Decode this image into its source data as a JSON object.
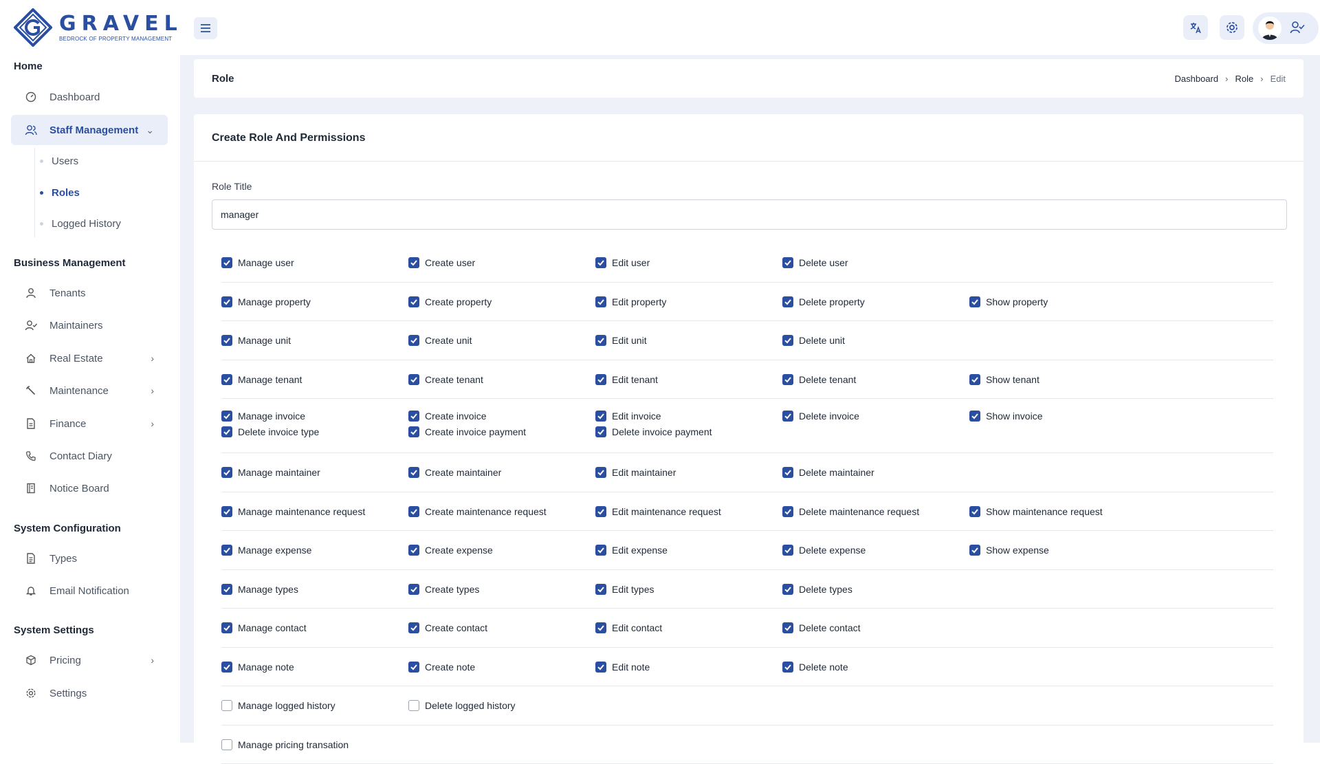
{
  "brand": {
    "name": "GRAVEL",
    "tagline": "BEDROCK OF PROPERTY MANAGEMENT"
  },
  "sidebar": {
    "sections": {
      "home": "Home",
      "business": "Business Management",
      "sysconfig": "System Configuration",
      "syssettings": "System Settings"
    },
    "items": {
      "dashboard": "Dashboard",
      "staff": "Staff Management",
      "users": "Users",
      "roles": "Roles",
      "logged": "Logged History",
      "tenants": "Tenants",
      "maintainers": "Maintainers",
      "realestate": "Real Estate",
      "maintenance": "Maintenance",
      "finance": "Finance",
      "contact": "Contact Diary",
      "notice": "Notice Board",
      "types": "Types",
      "email": "Email Notification",
      "pricing": "Pricing",
      "settings": "Settings"
    }
  },
  "header": {
    "title": "Role",
    "breadcrumb": [
      "Dashboard",
      "Role",
      "Edit"
    ]
  },
  "form": {
    "title": "Create Role And Permissions",
    "role_label": "Role Title",
    "role_value": "manager"
  },
  "permissions": [
    [
      {
        "l": "Manage user",
        "c": true
      },
      {
        "l": "Create user",
        "c": true
      },
      {
        "l": "Edit user",
        "c": true
      },
      {
        "l": "Delete user",
        "c": true
      }
    ],
    [
      {
        "l": "Manage property",
        "c": true
      },
      {
        "l": "Create property",
        "c": true
      },
      {
        "l": "Edit property",
        "c": true
      },
      {
        "l": "Delete property",
        "c": true
      },
      {
        "l": "Show property",
        "c": true
      }
    ],
    [
      {
        "l": "Manage unit",
        "c": true
      },
      {
        "l": "Create unit",
        "c": true
      },
      {
        "l": "Edit unit",
        "c": true
      },
      {
        "l": "Delete unit",
        "c": true
      }
    ],
    [
      {
        "l": "Manage tenant",
        "c": true
      },
      {
        "l": "Create tenant",
        "c": true
      },
      {
        "l": "Edit tenant",
        "c": true
      },
      {
        "l": "Delete tenant",
        "c": true
      },
      {
        "l": "Show tenant",
        "c": true
      }
    ],
    [
      {
        "l": "Manage invoice",
        "c": true
      },
      {
        "l": "Create invoice",
        "c": true
      },
      {
        "l": "Edit invoice",
        "c": true
      },
      {
        "l": "Delete invoice",
        "c": true
      },
      {
        "l": "Show invoice",
        "c": true
      },
      {
        "l": "Delete invoice type",
        "c": true
      },
      {
        "l": "Create invoice payment",
        "c": true
      },
      {
        "l": "Delete invoice payment",
        "c": true
      }
    ],
    [
      {
        "l": "Manage maintainer",
        "c": true
      },
      {
        "l": "Create maintainer",
        "c": true
      },
      {
        "l": "Edit maintainer",
        "c": true
      },
      {
        "l": "Delete maintainer",
        "c": true
      }
    ],
    [
      {
        "l": "Manage maintenance request",
        "c": true
      },
      {
        "l": "Create maintenance request",
        "c": true
      },
      {
        "l": "Edit maintenance request",
        "c": true
      },
      {
        "l": "Delete maintenance request",
        "c": true
      },
      {
        "l": "Show maintenance request",
        "c": true
      }
    ],
    [
      {
        "l": "Manage expense",
        "c": true
      },
      {
        "l": "Create expense",
        "c": true
      },
      {
        "l": "Edit expense",
        "c": true
      },
      {
        "l": "Delete expense",
        "c": true
      },
      {
        "l": "Show expense",
        "c": true
      }
    ],
    [
      {
        "l": "Manage types",
        "c": true
      },
      {
        "l": "Create types",
        "c": true
      },
      {
        "l": "Edit types",
        "c": true
      },
      {
        "l": "Delete types",
        "c": true
      }
    ],
    [
      {
        "l": "Manage contact",
        "c": true
      },
      {
        "l": "Create contact",
        "c": true
      },
      {
        "l": "Edit contact",
        "c": true
      },
      {
        "l": "Delete contact",
        "c": true
      }
    ],
    [
      {
        "l": "Manage note",
        "c": true
      },
      {
        "l": "Create note",
        "c": true
      },
      {
        "l": "Edit note",
        "c": true
      },
      {
        "l": "Delete note",
        "c": true
      }
    ],
    [
      {
        "l": "Manage logged history",
        "c": false
      },
      {
        "l": "Delete logged history",
        "c": false
      }
    ],
    [
      {
        "l": "Manage pricing transation",
        "c": false
      }
    ]
  ],
  "colors": {
    "accent": "#2a4ea0",
    "bg": "#eef1f7",
    "active_bg": "#e9eef9"
  }
}
